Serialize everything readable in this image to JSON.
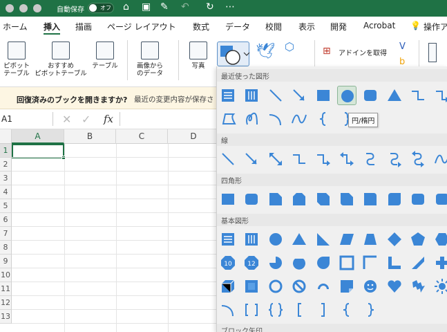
{
  "titlebar": {
    "autosave_label": "自動保存",
    "toggle_label": "オフ"
  },
  "menu": {
    "items": [
      "ホーム",
      "挿入",
      "描画",
      "ページ レイアウト",
      "数式",
      "データ",
      "校閲",
      "表示",
      "開発",
      "Acrobat",
      "操作アシ"
    ],
    "active": "挿入"
  },
  "ribbon": {
    "pivot_table": "ピボット\nテーブル",
    "recommended_pivot": "おすすめ\nピボットテーブル",
    "table": "テーブル",
    "image_from_data": "画像から\nのデータ",
    "pictures": "写真",
    "get_addins": "アドインを取得"
  },
  "message_bar": {
    "title": "回復済みのブックを開きますか?",
    "detail": "最近の変更内容が保存さ"
  },
  "formula_bar": {
    "name_box": "A1",
    "fx": "fx"
  },
  "grid": {
    "columns": [
      "A",
      "B",
      "C",
      "D"
    ],
    "rows": [
      "1",
      "2",
      "3",
      "4",
      "5",
      "6",
      "7",
      "8",
      "9",
      "10",
      "11",
      "12",
      "13"
    ]
  },
  "shapes_panel": {
    "sections": [
      "最近使った図形",
      "線",
      "四角形",
      "基本図形",
      "ブロック矢印"
    ],
    "tooltip": "円/楕円"
  },
  "colors": {
    "accent": "#1f7245",
    "shape_blue": "#3b86d6"
  }
}
